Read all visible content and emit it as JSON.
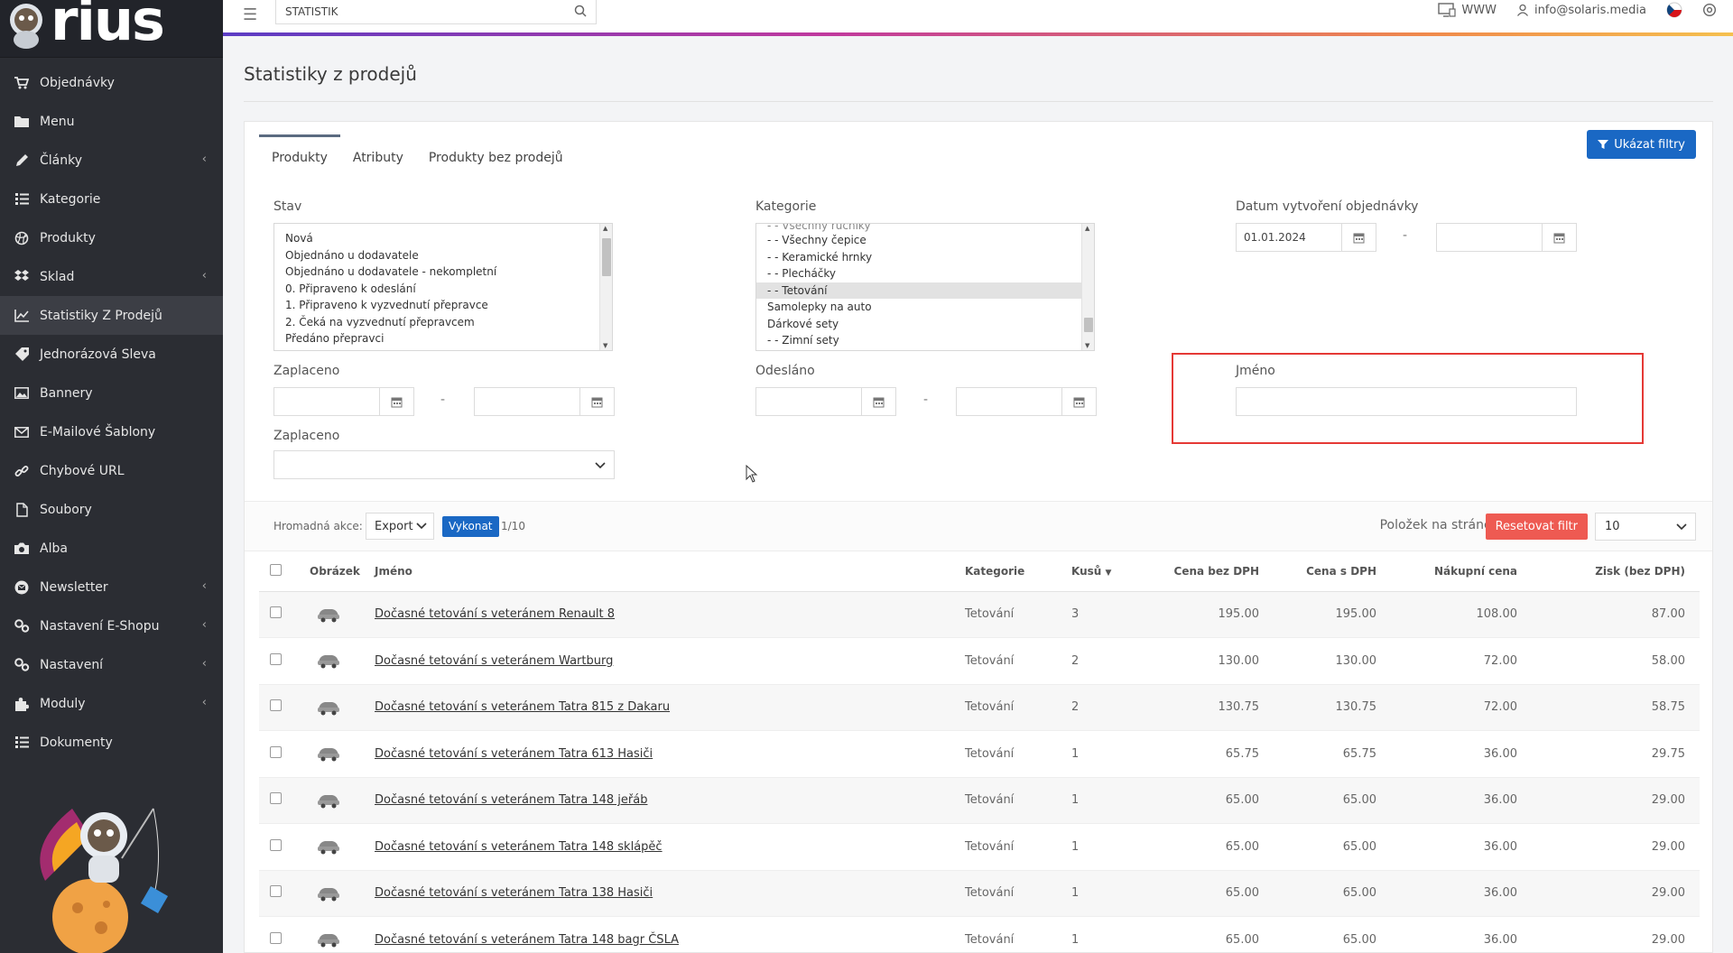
{
  "app": {
    "logo_text": "rius"
  },
  "sidebar": {
    "items": [
      {
        "label": "Objednávky",
        "icon": "cart-icon",
        "has_chevron": false,
        "active": false
      },
      {
        "label": "Menu",
        "icon": "folder-icon",
        "has_chevron": false,
        "active": false
      },
      {
        "label": "Články",
        "icon": "pencil-icon",
        "has_chevron": true,
        "active": false
      },
      {
        "label": "Kategorie",
        "icon": "list-icon",
        "has_chevron": false,
        "active": false
      },
      {
        "label": "Produkty",
        "icon": "ball-icon",
        "has_chevron": false,
        "active": false
      },
      {
        "label": "Sklad",
        "icon": "dropbox-icon",
        "has_chevron": true,
        "active": false
      },
      {
        "label": "Statistiky Z Prodejů",
        "icon": "chart-line-icon",
        "has_chevron": false,
        "active": true
      },
      {
        "label": "Jednorázová Sleva",
        "icon": "tag-icon",
        "has_chevron": false,
        "active": false
      },
      {
        "label": "Bannery",
        "icon": "image-icon",
        "has_chevron": false,
        "active": false
      },
      {
        "label": "E-Mailové Šablony",
        "icon": "envelope-icon",
        "has_chevron": false,
        "active": false
      },
      {
        "label": "Chybové URL",
        "icon": "link-icon",
        "has_chevron": false,
        "active": false
      },
      {
        "label": "Soubory",
        "icon": "file-icon",
        "has_chevron": false,
        "active": false
      },
      {
        "label": "Alba",
        "icon": "camera-icon",
        "has_chevron": false,
        "active": false
      },
      {
        "label": "Newsletter",
        "icon": "envelope-circle-icon",
        "has_chevron": true,
        "active": false
      },
      {
        "label": "Nastavení E-Shopu",
        "icon": "cogs-icon",
        "has_chevron": true,
        "active": false
      },
      {
        "label": "Nastavení",
        "icon": "cogs-icon",
        "has_chevron": true,
        "active": false
      },
      {
        "label": "Moduly",
        "icon": "puzzle-icon",
        "has_chevron": true,
        "active": false
      },
      {
        "label": "Dokumenty",
        "icon": "list-icon",
        "has_chevron": false,
        "active": false
      }
    ]
  },
  "topbar": {
    "search_value": "STATISTIK",
    "www_label": "WWW",
    "user_email": "info@solaris.media"
  },
  "page": {
    "title": "Statistiky z prodejů"
  },
  "tabs": [
    {
      "label": "Produkty",
      "active": true
    },
    {
      "label": "Atributy",
      "active": false
    },
    {
      "label": "Produkty bez prodejů",
      "active": false
    }
  ],
  "filters": {
    "toggle_label": "Ukázat filtry",
    "stav": {
      "label": "Stav",
      "options": [
        "Nová",
        "Objednáno u dodavatele",
        "Objednáno u dodavatele - nekompletní",
        "0. Připraveno k odeslání",
        "1. Připraveno k vyzvednutí přepravce",
        "2. Čeká na vyzvednutí přepravcem",
        "Předáno přepravci"
      ]
    },
    "kategorie": {
      "label": "Kategorie",
      "partial_top": "- - Všechny ručníky",
      "options": [
        "- - Všechny čepice",
        "- - Keramické hrnky",
        "- - Plecháčky",
        "- - Tetování",
        "Samolepky na auto",
        "Dárkové sety",
        "- - Zimní sety"
      ],
      "selected": "- - Tetování"
    },
    "datum": {
      "label": "Datum vytvoření objednávky",
      "from": "01.01.2024",
      "to": ""
    },
    "zaplaceno_dates": {
      "label": "Zaplaceno"
    },
    "odeslano": {
      "label": "Odesláno"
    },
    "jmeno": {
      "label": "Jméno",
      "value": ""
    },
    "zaplaceno_select": {
      "label": "Zaplaceno",
      "value": ""
    },
    "range_dash": "-"
  },
  "bulk": {
    "label": "Hromadná akce:",
    "action": "Export",
    "execute_label": "Vykonat",
    "count": "1/10",
    "per_page_label": "Položek na stránce:",
    "reset_label": "Resetovat filtr",
    "per_page_value": "10"
  },
  "table": {
    "columns": [
      "Obrázek",
      "Jméno",
      "Kategorie",
      "Kusů",
      "Cena bez DPH",
      "Cena s DPH",
      "Nákupní cena",
      "Zisk (bez DPH)"
    ],
    "rows": [
      {
        "name": "Dočasné tetování s veteránem Renault 8",
        "category": "Tetování",
        "qty": "3",
        "price_ex": "195.00",
        "price_inc": "195.00",
        "purchase": "108.00",
        "profit": "87.00"
      },
      {
        "name": "Dočasné tetování s veteránem Wartburg",
        "category": "Tetování",
        "qty": "2",
        "price_ex": "130.00",
        "price_inc": "130.00",
        "purchase": "72.00",
        "profit": "58.00"
      },
      {
        "name": "Dočasné tetování s veteránem Tatra 815 z Dakaru",
        "category": "Tetování",
        "qty": "2",
        "price_ex": "130.75",
        "price_inc": "130.75",
        "purchase": "72.00",
        "profit": "58.75"
      },
      {
        "name": "Dočasné tetování s veteránem Tatra 613 Hasiči",
        "category": "Tetování",
        "qty": "1",
        "price_ex": "65.75",
        "price_inc": "65.75",
        "purchase": "36.00",
        "profit": "29.75"
      },
      {
        "name": "Dočasné tetování s veteránem Tatra 148 jeřáb",
        "category": "Tetování",
        "qty": "1",
        "price_ex": "65.00",
        "price_inc": "65.00",
        "purchase": "36.00",
        "profit": "29.00"
      },
      {
        "name": "Dočasné tetování s veteránem Tatra 148 sklápěč",
        "category": "Tetování",
        "qty": "1",
        "price_ex": "65.00",
        "price_inc": "65.00",
        "purchase": "36.00",
        "profit": "29.00"
      },
      {
        "name": "Dočasné tetování s veteránem Tatra 138 Hasiči",
        "category": "Tetování",
        "qty": "1",
        "price_ex": "65.00",
        "price_inc": "65.00",
        "purchase": "36.00",
        "profit": "29.00"
      },
      {
        "name": "Dočasné tetování s veteránem Tatra 148 bagr ČSLA",
        "category": "Tetování",
        "qty": "1",
        "price_ex": "65.00",
        "price_inc": "65.00",
        "purchase": "36.00",
        "profit": "29.00"
      }
    ]
  },
  "colors": {
    "sidebar_bg": "#2b2d33",
    "primary": "#1a68c4",
    "danger": "#ee5a52",
    "highlight": "#e53935"
  }
}
